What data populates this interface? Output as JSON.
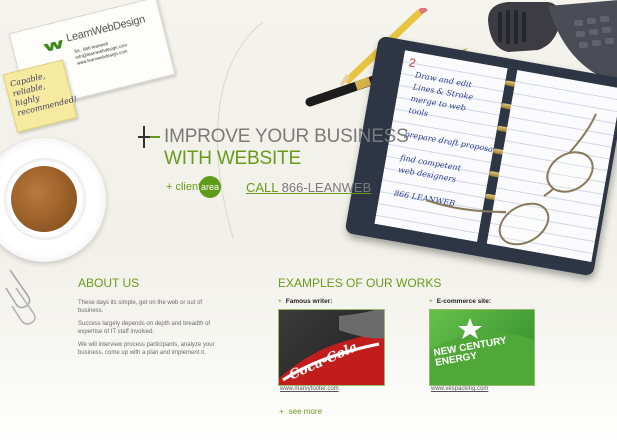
{
  "colors": {
    "accent_green": "#6a9a1a",
    "text_gray": "#7a7a7a",
    "background": "#f3f2eb"
  },
  "business_card": {
    "brand": "LearnWebDesign",
    "lines": [
      "Tel.: 866-leanweb",
      "info@learnwebdesign.com",
      "www.learnwebdesign.com"
    ]
  },
  "sticky_note": {
    "text": "Capable, reliable, highly recommended!"
  },
  "organizer": {
    "page_number": "2",
    "handwriting": [
      "Draw and edit",
      "Lines & Stroke",
      "merge to web",
      "tools",
      "prepare draft proposal",
      "find competent",
      "web designers",
      "866 LEANWEB"
    ]
  },
  "hero": {
    "headline_line1": "IMPROVE YOUR BUSINESS",
    "headline_line2": "WITH WEBSITE",
    "client_prefix": "+ client",
    "client_area_label": "area",
    "call_label": "CALL",
    "call_number": "866-LEANWEB"
  },
  "about": {
    "title": "ABOUT US",
    "paragraphs": [
      "These days its simple, get on the web or out of business.",
      "Success largely depends on depth and breadth of expertise of IT staff involved.",
      "We will interview process participants, analyze your business, come up with a plan and implement it."
    ]
  },
  "works": {
    "title": "EXAMPLES OF OUR WORKS",
    "items": [
      {
        "label": "Famous writer:",
        "url": "www.marvytooter.com",
        "thumb_text": "Coca-Cola"
      },
      {
        "label": "E-commerce site:",
        "url": "www.vespacking.com",
        "thumb_text": "NEW CENTURY ENERGY"
      }
    ],
    "see_more": "see more"
  }
}
